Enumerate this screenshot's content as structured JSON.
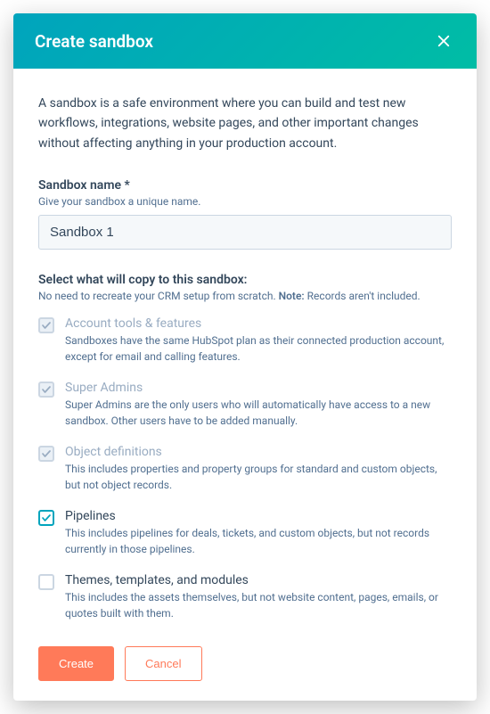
{
  "header": {
    "title": "Create sandbox"
  },
  "intro": "A sandbox is a safe environment where you can build and test new workflows, integrations, website pages, and other important changes without affecting anything in your production account.",
  "nameField": {
    "label": "Sandbox name *",
    "help": "Give your sandbox a unique name.",
    "value": "Sandbox 1"
  },
  "copySection": {
    "label": "Select what will copy to this sandbox:",
    "help_prefix": "No need to recreate your CRM setup from scratch. ",
    "help_note": "Note:",
    "help_suffix": " Records aren't included."
  },
  "options": [
    {
      "title": "Account tools & features",
      "desc": "Sandboxes have the same HubSpot plan as their connected production account, except for email and calling features.",
      "checked": true,
      "enabled": false
    },
    {
      "title": "Super Admins",
      "desc": "Super Admins are the only users who will automatically have access to a new sandbox. Other users have to be added manually.",
      "checked": true,
      "enabled": false
    },
    {
      "title": "Object definitions",
      "desc": "This includes properties and property groups for standard and custom objects, but not object records.",
      "checked": true,
      "enabled": false
    },
    {
      "title": "Pipelines",
      "desc": "This includes pipelines for deals, tickets, and custom objects, but not records currently in those pipelines.",
      "checked": true,
      "enabled": true
    },
    {
      "title": "Themes, templates, and modules",
      "desc": "This includes the assets themselves, but not website content, pages, emails, or quotes built with them.",
      "checked": false,
      "enabled": true
    }
  ],
  "footer": {
    "create": "Create",
    "cancel": "Cancel"
  }
}
